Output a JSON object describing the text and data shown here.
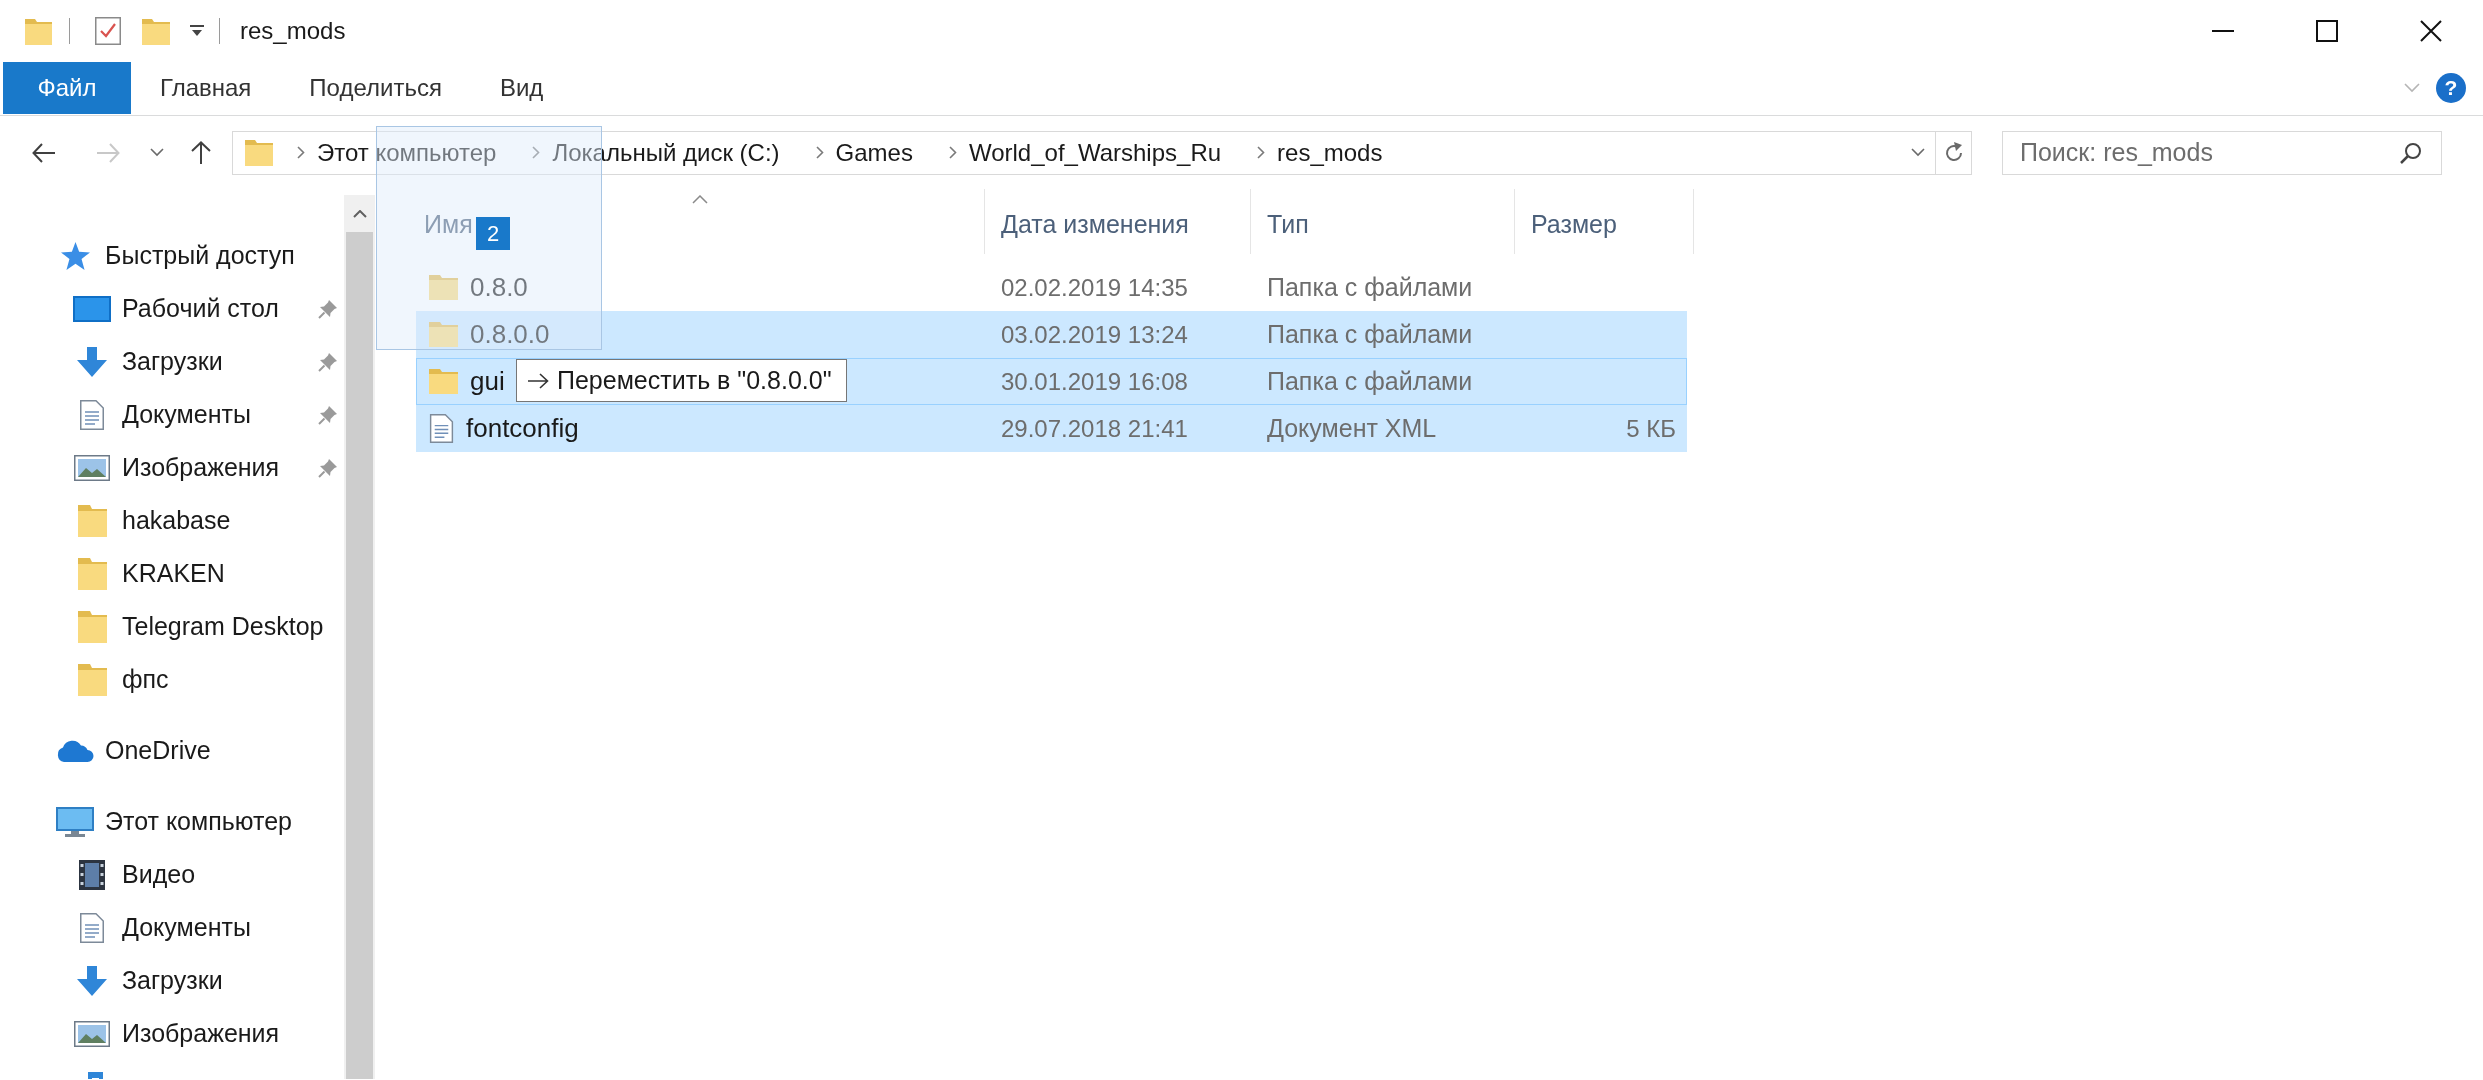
{
  "window": {
    "title": "res_mods",
    "help_button": "?"
  },
  "ribbon": {
    "tabs": [
      {
        "label": "Файл",
        "kind": "file",
        "selected": false
      },
      {
        "label": "Главная",
        "kind": "tab",
        "selected": false
      },
      {
        "label": "Поделиться",
        "kind": "tab",
        "selected": false
      },
      {
        "label": "Вид",
        "kind": "tab",
        "selected": false
      }
    ]
  },
  "navigation": {
    "back": {
      "disabled": false
    },
    "forward": {
      "disabled": true
    },
    "up": {
      "disabled": false
    }
  },
  "address_bar": {
    "breadcrumbs": [
      "Этот компьютер",
      "Локальный диск (C:)",
      "Games",
      "World_of_Warships_Ru",
      "res_mods"
    ]
  },
  "search": {
    "placeholder": "Поиск: res_mods"
  },
  "sidebar": {
    "items": [
      {
        "label": "Быстрый доступ",
        "kind": "star",
        "children": [
          {
            "label": "Рабочий стол",
            "kind": "desktop",
            "pinned": true
          },
          {
            "label": "Загрузки",
            "kind": "download",
            "pinned": true
          },
          {
            "label": "Документы",
            "kind": "document",
            "pinned": true
          },
          {
            "label": "Изображения",
            "kind": "pictures",
            "pinned": true
          },
          {
            "label": "hakabase",
            "kind": "folder",
            "pinned": false
          },
          {
            "label": "KRAKEN",
            "kind": "folder",
            "pinned": false
          },
          {
            "label": "Telegram Desktop",
            "kind": "folder",
            "pinned": false
          },
          {
            "label": "фпс",
            "kind": "folder",
            "pinned": false
          }
        ]
      },
      {
        "label": "OneDrive",
        "kind": "cloud"
      },
      {
        "label": "Этот компьютер",
        "kind": "computer",
        "children": [
          {
            "label": "Видео",
            "kind": "video"
          },
          {
            "label": "Документы",
            "kind": "document"
          },
          {
            "label": "Загрузки",
            "kind": "download"
          },
          {
            "label": "Изображения",
            "kind": "pictures"
          },
          {
            "kind": "music"
          }
        ]
      }
    ]
  },
  "file_list": {
    "columns": [
      {
        "label": "Имя",
        "sorted": true
      },
      {
        "label": "Дата изменения",
        "sorted": false
      },
      {
        "label": "Тип",
        "sorted": false
      },
      {
        "label": "Размер",
        "sorted": false
      }
    ],
    "rows": [
      {
        "name": "0.8.0",
        "kind": "folder",
        "date": "02.02.2019 14:35",
        "type": "Папка с файлами",
        "selected": false,
        "focused": false
      },
      {
        "name": "0.8.0.0",
        "kind": "folder",
        "date": "03.02.2019 13:24",
        "type": "Папка с файлами",
        "selected": true,
        "focused": false
      },
      {
        "name": "gui",
        "kind": "folder",
        "date": "30.01.2019 16:08",
        "type": "Папка с файлами",
        "selected": true,
        "focused": true
      },
      {
        "name": "fontconfig",
        "kind": "file",
        "date": "29.07.2018 21:41",
        "type": "Документ XML",
        "size": "5 КБ",
        "selected": true,
        "focused": false
      }
    ]
  },
  "drag": {
    "count": "2",
    "tooltip": "Переместить в \"0.8.0.0\""
  }
}
